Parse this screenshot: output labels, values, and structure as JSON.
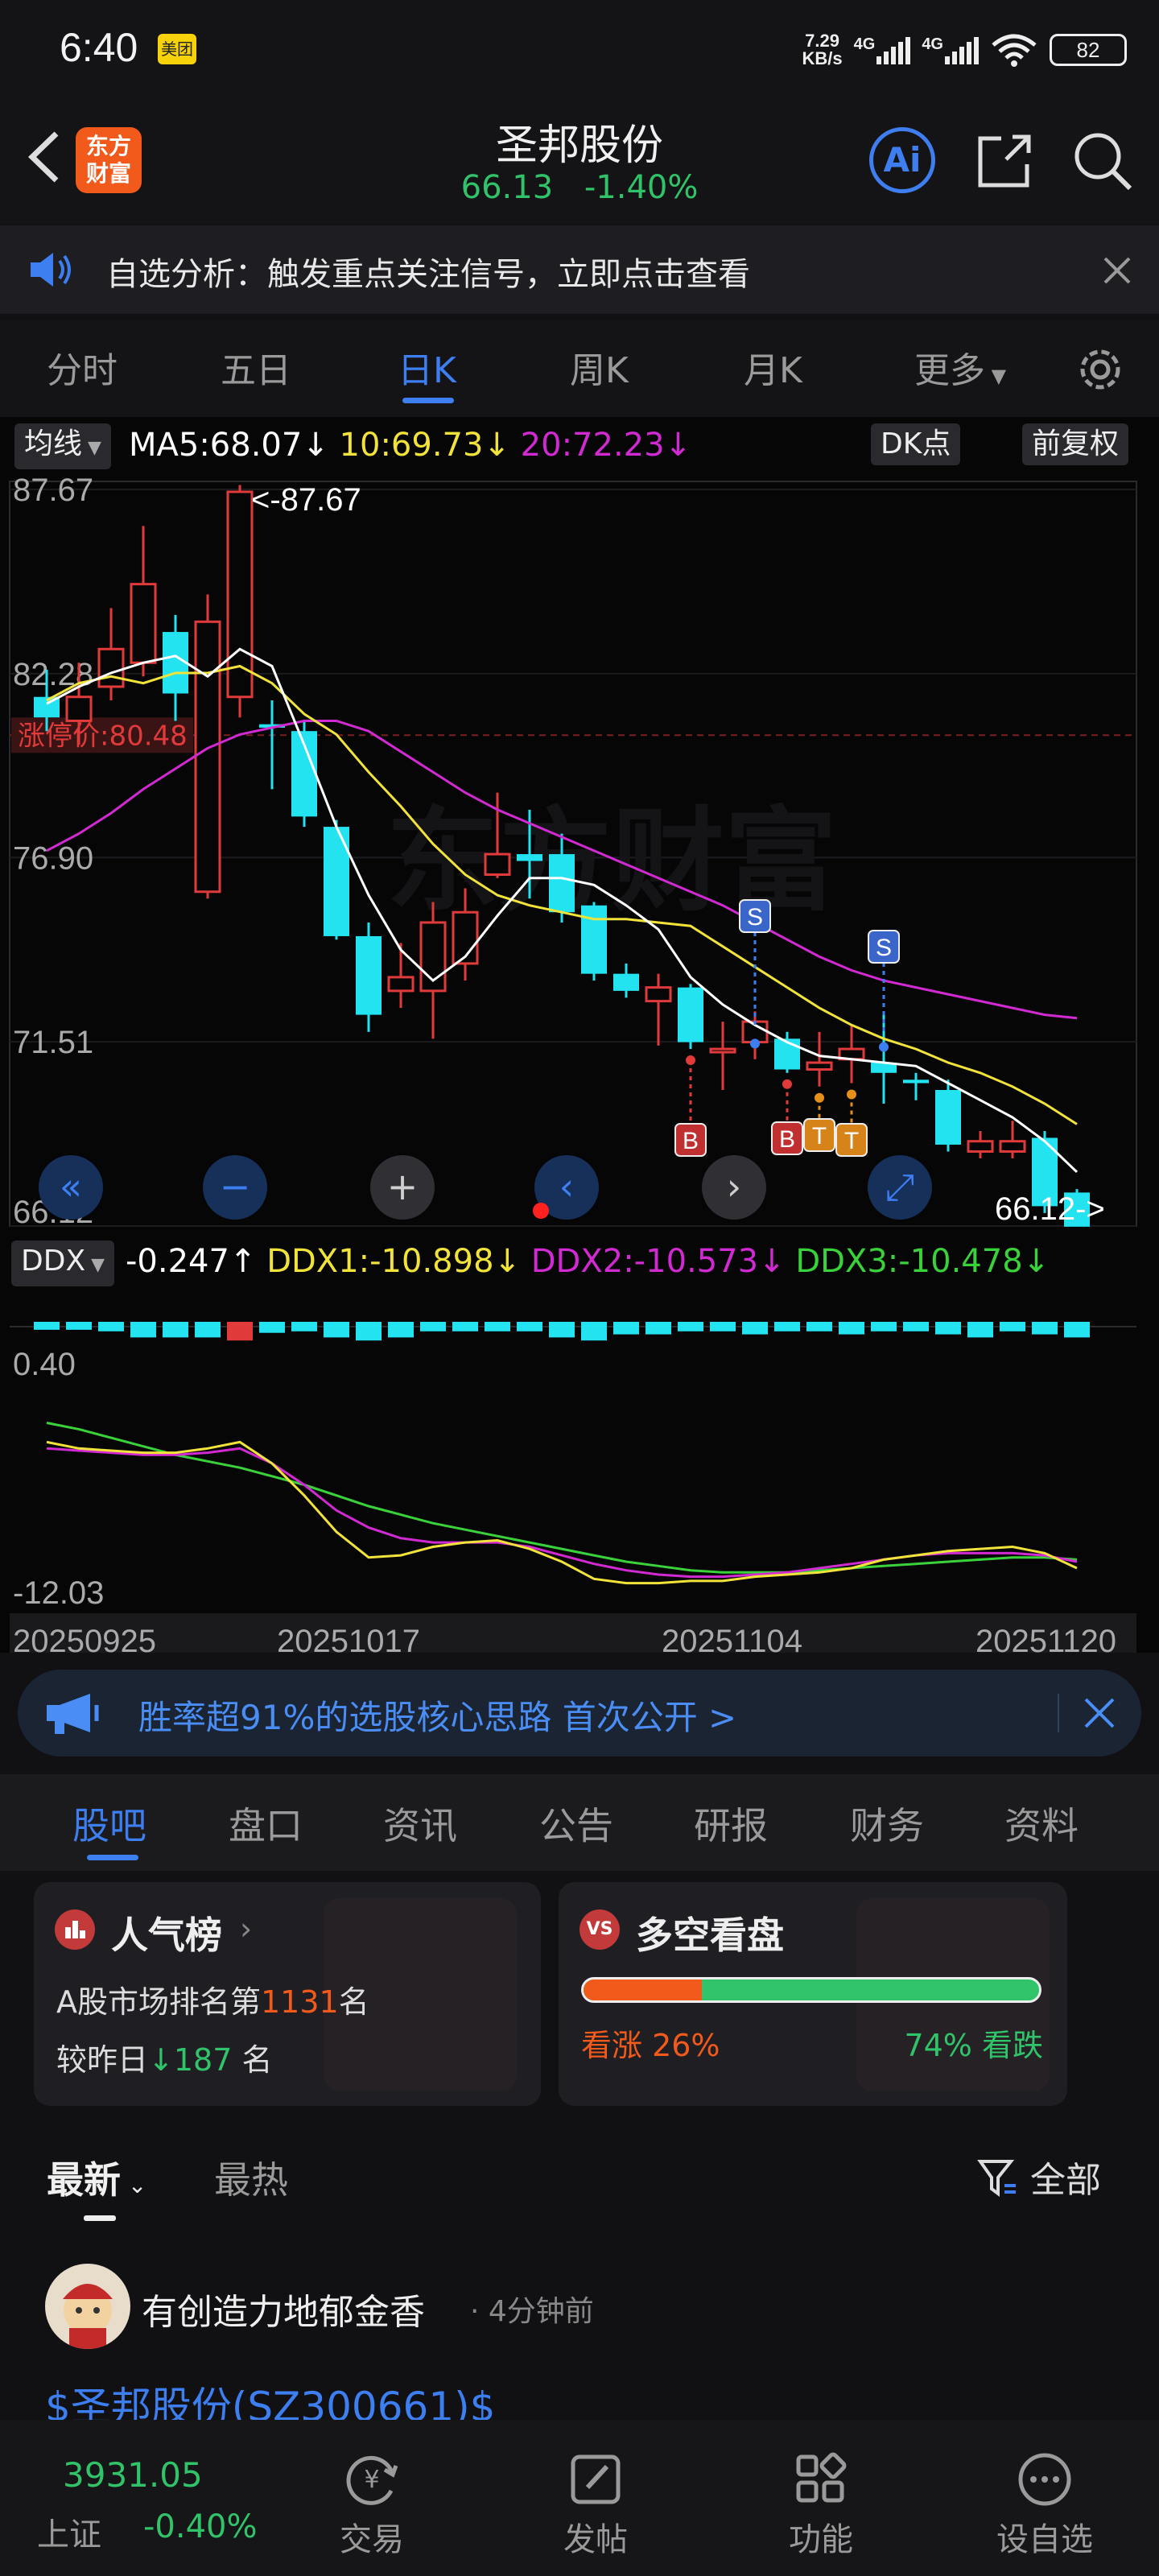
{
  "status": {
    "time": "6:40",
    "app_badge": "美团",
    "net_speed_top": "7.29",
    "net_speed_bottom": "KB/s",
    "net1": "4G",
    "net2": "4G",
    "battery": "82"
  },
  "header": {
    "brand_line1": "东方",
    "brand_line2": "财富",
    "title": "圣邦股份",
    "price": "66.13",
    "change": "-1.40%",
    "ai_label": "Ai"
  },
  "notice": {
    "text": "自选分析：触发重点关注信号，立即点击查看"
  },
  "chart_tabs": [
    "分时",
    "五日",
    "日K",
    "周K",
    "月K",
    "更多"
  ],
  "kline": {
    "indicator_select": "均线",
    "ma5": "MA5:68.07",
    "ma10": "10:69.73",
    "ma20": "20:72.23",
    "dk_button": "DK点",
    "adjust_button": "前复权",
    "limit_label": "涨停价:80.48",
    "max_label": "<-87.67",
    "min_label": "66.12->",
    "ddx_select": "DDX",
    "ddx": "-0.247",
    "ddx1": "DDX1:-10.898",
    "ddx2": "DDX2:-10.573",
    "ddx3": "DDX3:-10.478",
    "ddx_top": "0.40",
    "ddx_bottom": "-12.03",
    "signals": [
      "B",
      "B",
      "T",
      "T",
      "S",
      "S"
    ]
  },
  "chart_data": {
    "type": "candlestick",
    "y_ticks": [
      "87.67",
      "82.28",
      "76.90",
      "71.51",
      "66.12"
    ],
    "ylim": [
      66.12,
      87.67
    ],
    "x_labels": [
      "20250925",
      "20251017",
      "20251104",
      "20251120"
    ],
    "candles": [
      {
        "o": 81.6,
        "c": 81.0,
        "h": 82.4,
        "l": 80.6
      },
      {
        "o": 80.9,
        "c": 81.6,
        "h": 82.6,
        "l": 80.2
      },
      {
        "o": 81.9,
        "c": 83.0,
        "h": 84.2,
        "l": 81.5
      },
      {
        "o": 82.6,
        "c": 84.9,
        "h": 86.6,
        "l": 82.2
      },
      {
        "o": 83.5,
        "c": 81.7,
        "h": 84.0,
        "l": 80.9
      },
      {
        "o": 75.9,
        "c": 83.8,
        "h": 84.6,
        "l": 75.7
      },
      {
        "o": 81.6,
        "c": 87.6,
        "h": 87.8,
        "l": 81.0
      },
      {
        "o": 80.8,
        "c": 80.7,
        "h": 81.5,
        "l": 78.9
      },
      {
        "o": 80.6,
        "c": 78.1,
        "h": 80.9,
        "l": 77.8
      },
      {
        "o": 77.8,
        "c": 74.6,
        "h": 78.0,
        "l": 74.5
      },
      {
        "o": 74.6,
        "c": 72.3,
        "h": 75.0,
        "l": 71.8
      },
      {
        "o": 73.0,
        "c": 73.4,
        "h": 74.4,
        "l": 72.5
      },
      {
        "o": 73.0,
        "c": 75.0,
        "h": 75.6,
        "l": 71.6
      },
      {
        "o": 73.8,
        "c": 75.3,
        "h": 76.0,
        "l": 73.3
      },
      {
        "o": 76.4,
        "c": 77.0,
        "h": 78.8,
        "l": 76.3
      },
      {
        "o": 77.0,
        "c": 76.8,
        "h": 78.3,
        "l": 75.7
      },
      {
        "o": 77.0,
        "c": 75.3,
        "h": 77.6,
        "l": 75.0
      },
      {
        "o": 75.5,
        "c": 73.5,
        "h": 75.6,
        "l": 73.3
      },
      {
        "o": 73.5,
        "c": 73.0,
        "h": 73.8,
        "l": 72.8
      },
      {
        "o": 72.7,
        "c": 73.1,
        "h": 73.5,
        "l": 71.4
      },
      {
        "o": 73.1,
        "c": 71.5,
        "h": 73.2,
        "l": 71.3
      },
      {
        "o": 71.3,
        "c": 71.3,
        "h": 72.1,
        "l": 70.1
      },
      {
        "o": 71.5,
        "c": 72.1,
        "h": 72.4,
        "l": 71.0
      },
      {
        "o": 71.6,
        "c": 70.7,
        "h": 71.8,
        "l": 70.6
      },
      {
        "o": 70.7,
        "c": 70.9,
        "h": 71.8,
        "l": 70.2
      },
      {
        "o": 71.0,
        "c": 71.3,
        "h": 72.0,
        "l": 70.3
      },
      {
        "o": 70.9,
        "c": 70.6,
        "h": 72.3,
        "l": 69.7
      },
      {
        "o": 70.4,
        "c": 70.3,
        "h": 70.6,
        "l": 69.8
      },
      {
        "o": 70.1,
        "c": 68.5,
        "h": 70.4,
        "l": 68.3
      },
      {
        "o": 68.3,
        "c": 68.6,
        "h": 68.9,
        "l": 68.1
      },
      {
        "o": 68.3,
        "c": 68.6,
        "h": 69.2,
        "l": 68.1
      },
      {
        "o": 68.7,
        "c": 66.7,
        "h": 68.9,
        "l": 66.5
      },
      {
        "o": 67.1,
        "c": 66.1,
        "h": 67.2,
        "l": 66.12
      }
    ],
    "ma5": [
      81.4,
      81.9,
      82.3,
      82.6,
      82.8,
      82.2,
      83.0,
      82.5,
      80.2,
      77.8,
      75.8,
      74.2,
      73.3,
      74.0,
      75.2,
      76.3,
      76.3,
      76.1,
      75.5,
      74.8,
      73.4,
      72.6,
      72.0,
      71.5,
      71.1,
      71.0,
      70.9,
      70.8,
      70.3,
      69.8,
      69.3,
      68.6,
      67.7
    ],
    "ma10": [
      81.5,
      82.0,
      82.2,
      82.0,
      82.3,
      82.3,
      82.5,
      82.0,
      81.1,
      80.5,
      79.4,
      78.4,
      77.3,
      76.4,
      75.8,
      75.5,
      75.3,
      75.1,
      75.1,
      75.0,
      74.9,
      74.3,
      73.7,
      73.1,
      72.5,
      72.0,
      71.6,
      71.3,
      70.9,
      70.6,
      70.2,
      69.7,
      69.1
    ],
    "ma20": [
      77.1,
      77.6,
      78.2,
      78.9,
      79.5,
      80.1,
      80.5,
      80.7,
      80.9,
      80.9,
      80.6,
      80.0,
      79.4,
      78.8,
      78.3,
      77.9,
      77.5,
      77.1,
      76.7,
      76.3,
      75.9,
      75.5,
      75.0,
      74.5,
      74.0,
      73.6,
      73.3,
      73.1,
      72.9,
      72.7,
      72.5,
      72.3,
      72.2
    ],
    "ddx_bars": [
      0.05,
      0.05,
      0.1,
      0.3,
      0.3,
      0.3,
      0.4,
      0.15,
      0.1,
      0.3,
      0.4,
      0.3,
      0.1,
      0.1,
      0.1,
      0.1,
      0.3,
      0.4,
      0.2,
      0.2,
      0.1,
      0.1,
      0.2,
      0.1,
      0.1,
      0.2,
      0.1,
      0.1,
      0.2,
      0.3,
      0.1,
      0.2,
      0.3
    ],
    "ddx_red": [
      6
    ],
    "ddx_ylim": [
      -12.03,
      0.4
    ],
    "ddx1": [
      -5.0,
      -5.3,
      -5.4,
      -5.5,
      -5.5,
      -5.3,
      -5.0,
      -6.0,
      -7.5,
      -9.2,
      -10.4,
      -10.3,
      -9.9,
      -9.7,
      -9.6,
      -10.0,
      -10.6,
      -11.4,
      -11.6,
      -11.6,
      -11.5,
      -11.5,
      -11.3,
      -11.2,
      -11.1,
      -10.9,
      -10.5,
      -10.3,
      -10.1,
      -10.0,
      -9.9,
      -10.2,
      -10.9
    ],
    "ddx2": [
      -5.3,
      -5.4,
      -5.5,
      -5.6,
      -5.6,
      -5.5,
      -5.3,
      -6.0,
      -7.0,
      -8.2,
      -9.0,
      -9.5,
      -9.7,
      -9.7,
      -9.7,
      -9.9,
      -10.3,
      -10.7,
      -11.0,
      -11.2,
      -11.3,
      -11.3,
      -11.2,
      -11.1,
      -10.9,
      -10.7,
      -10.5,
      -10.3,
      -10.2,
      -10.2,
      -10.2,
      -10.3,
      -10.6
    ],
    "ddx3": [
      -4.1,
      -4.4,
      -4.8,
      -5.2,
      -5.6,
      -5.9,
      -6.2,
      -6.6,
      -7.0,
      -7.5,
      -8.0,
      -8.4,
      -8.8,
      -9.1,
      -9.4,
      -9.7,
      -10.0,
      -10.3,
      -10.6,
      -10.8,
      -11.0,
      -11.1,
      -11.1,
      -11.1,
      -11.0,
      -10.9,
      -10.8,
      -10.7,
      -10.6,
      -10.5,
      -10.4,
      -10.4,
      -10.5
    ]
  },
  "promo_banner": {
    "text": "胜率超91%的选股核心思路 首次公开 >"
  },
  "sub_tabs": [
    "股吧",
    "盘口",
    "资讯",
    "公告",
    "研报",
    "财务",
    "资料"
  ],
  "popularity": {
    "title": "人气榜",
    "rank_prefix": "A股市场排名第",
    "rank": "1131",
    "rank_suffix": "名",
    "change_prefix": "较昨日",
    "change": "187",
    "change_suffix": "名"
  },
  "sentiment": {
    "title": "多空看盘",
    "bull_label": "看涨 26%",
    "bear_label": "74% 看跌",
    "bull_fraction": 0.26
  },
  "sort": {
    "latest": "最新",
    "hot": "最热",
    "filter": "全部"
  },
  "post": {
    "author": "有创造力地郁金香",
    "time": "· 4分钟前",
    "text": "$圣邦股份(SZ300661)$"
  },
  "bottom_bar": {
    "index_value": "3931.05",
    "index_name": "上证",
    "index_change": "-0.40%",
    "items": [
      "交易",
      "发帖",
      "功能",
      "设自选"
    ]
  },
  "colors": {
    "up": "#e03a3a",
    "down": "#22e3ef",
    "accent": "#3d7ef0",
    "ma5": "#ffffff",
    "ma10": "#f2e33a",
    "ma20": "#d22ad2",
    "ddx3": "#3ad23a",
    "green": "#31c36a"
  }
}
